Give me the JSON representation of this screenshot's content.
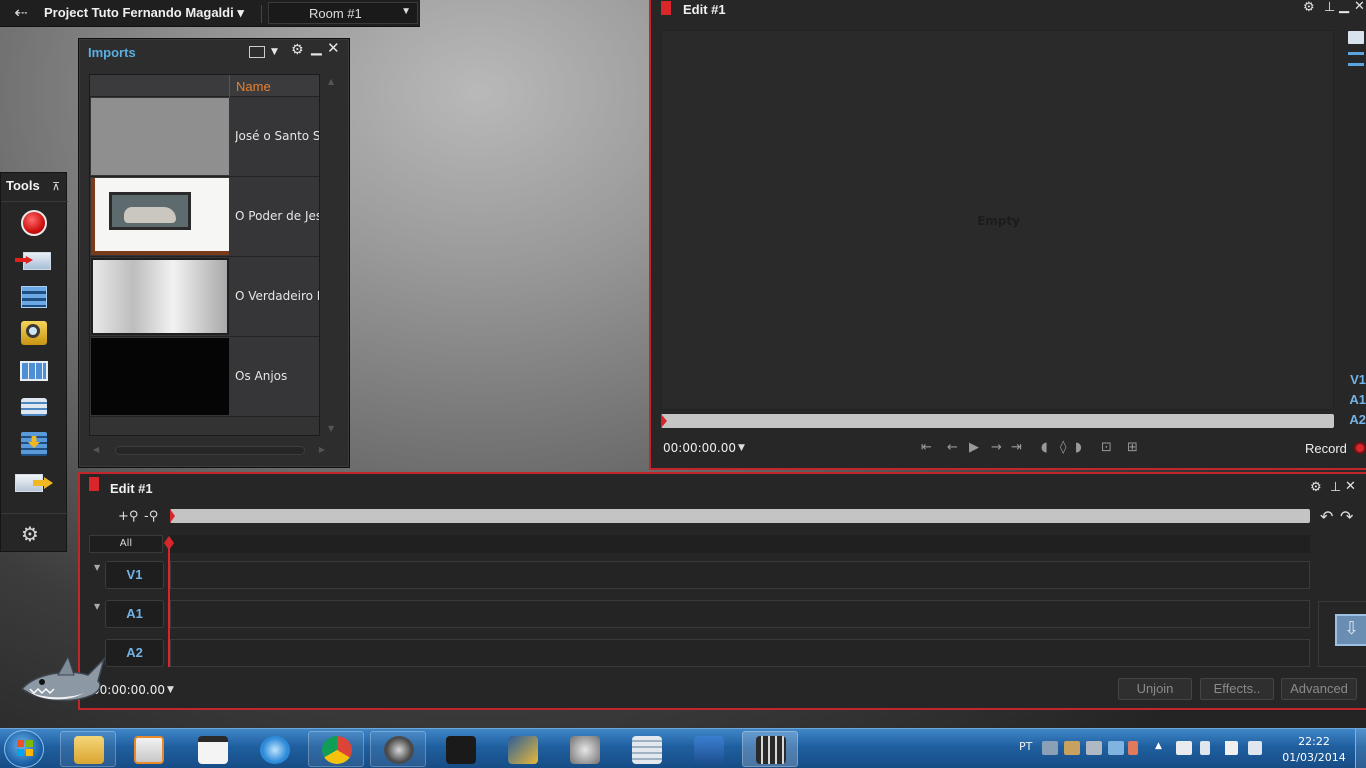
{
  "project_bar": {
    "title": "Project Tuto Fernando Magaldi ▾",
    "room": "Room #1"
  },
  "imports": {
    "title": "Imports",
    "column_name": "Name",
    "rows": [
      {
        "name": "José o Santo S"
      },
      {
        "name": "O Poder de Jes"
      },
      {
        "name": "O Verdadeiro L"
      },
      {
        "name": "Os Anjos"
      }
    ]
  },
  "tools": {
    "title": "Tools",
    "items": [
      {
        "icon": "record-icon"
      },
      {
        "icon": "import-arrow-icon"
      },
      {
        "icon": "timeline-grid-icon"
      },
      {
        "icon": "search-icon"
      },
      {
        "icon": "table-icon"
      },
      {
        "icon": "stack-icon"
      },
      {
        "icon": "download-icon"
      },
      {
        "icon": "export-arrow-icon"
      },
      {
        "icon": "users-settings-icon"
      }
    ]
  },
  "viewer": {
    "title": "Edit #1",
    "empty_label": "Empty",
    "tracks": [
      "V1",
      "A1",
      "A2"
    ],
    "timecode": "00:00:00.00",
    "record_label": "Record"
  },
  "timeline": {
    "title": "Edit #1",
    "zoom_in": "+⚲",
    "zoom_out": "-⚲",
    "all_label": "All",
    "tracks": [
      "V1",
      "A1",
      "A2"
    ],
    "timecode": "00:00:00.00",
    "buttons": {
      "unjoin": "Unjoin",
      "effects": "Effects..",
      "advanced": "Advanced"
    }
  },
  "taskbar": {
    "lang": "PT",
    "time": "22:22",
    "date": "01/03/2014"
  },
  "colors": {
    "accent_red": "#c0262b",
    "imports_title_blue": "#5aaee0",
    "name_header_orange": "#e88030",
    "track_label_blue": "#74b3e6"
  }
}
